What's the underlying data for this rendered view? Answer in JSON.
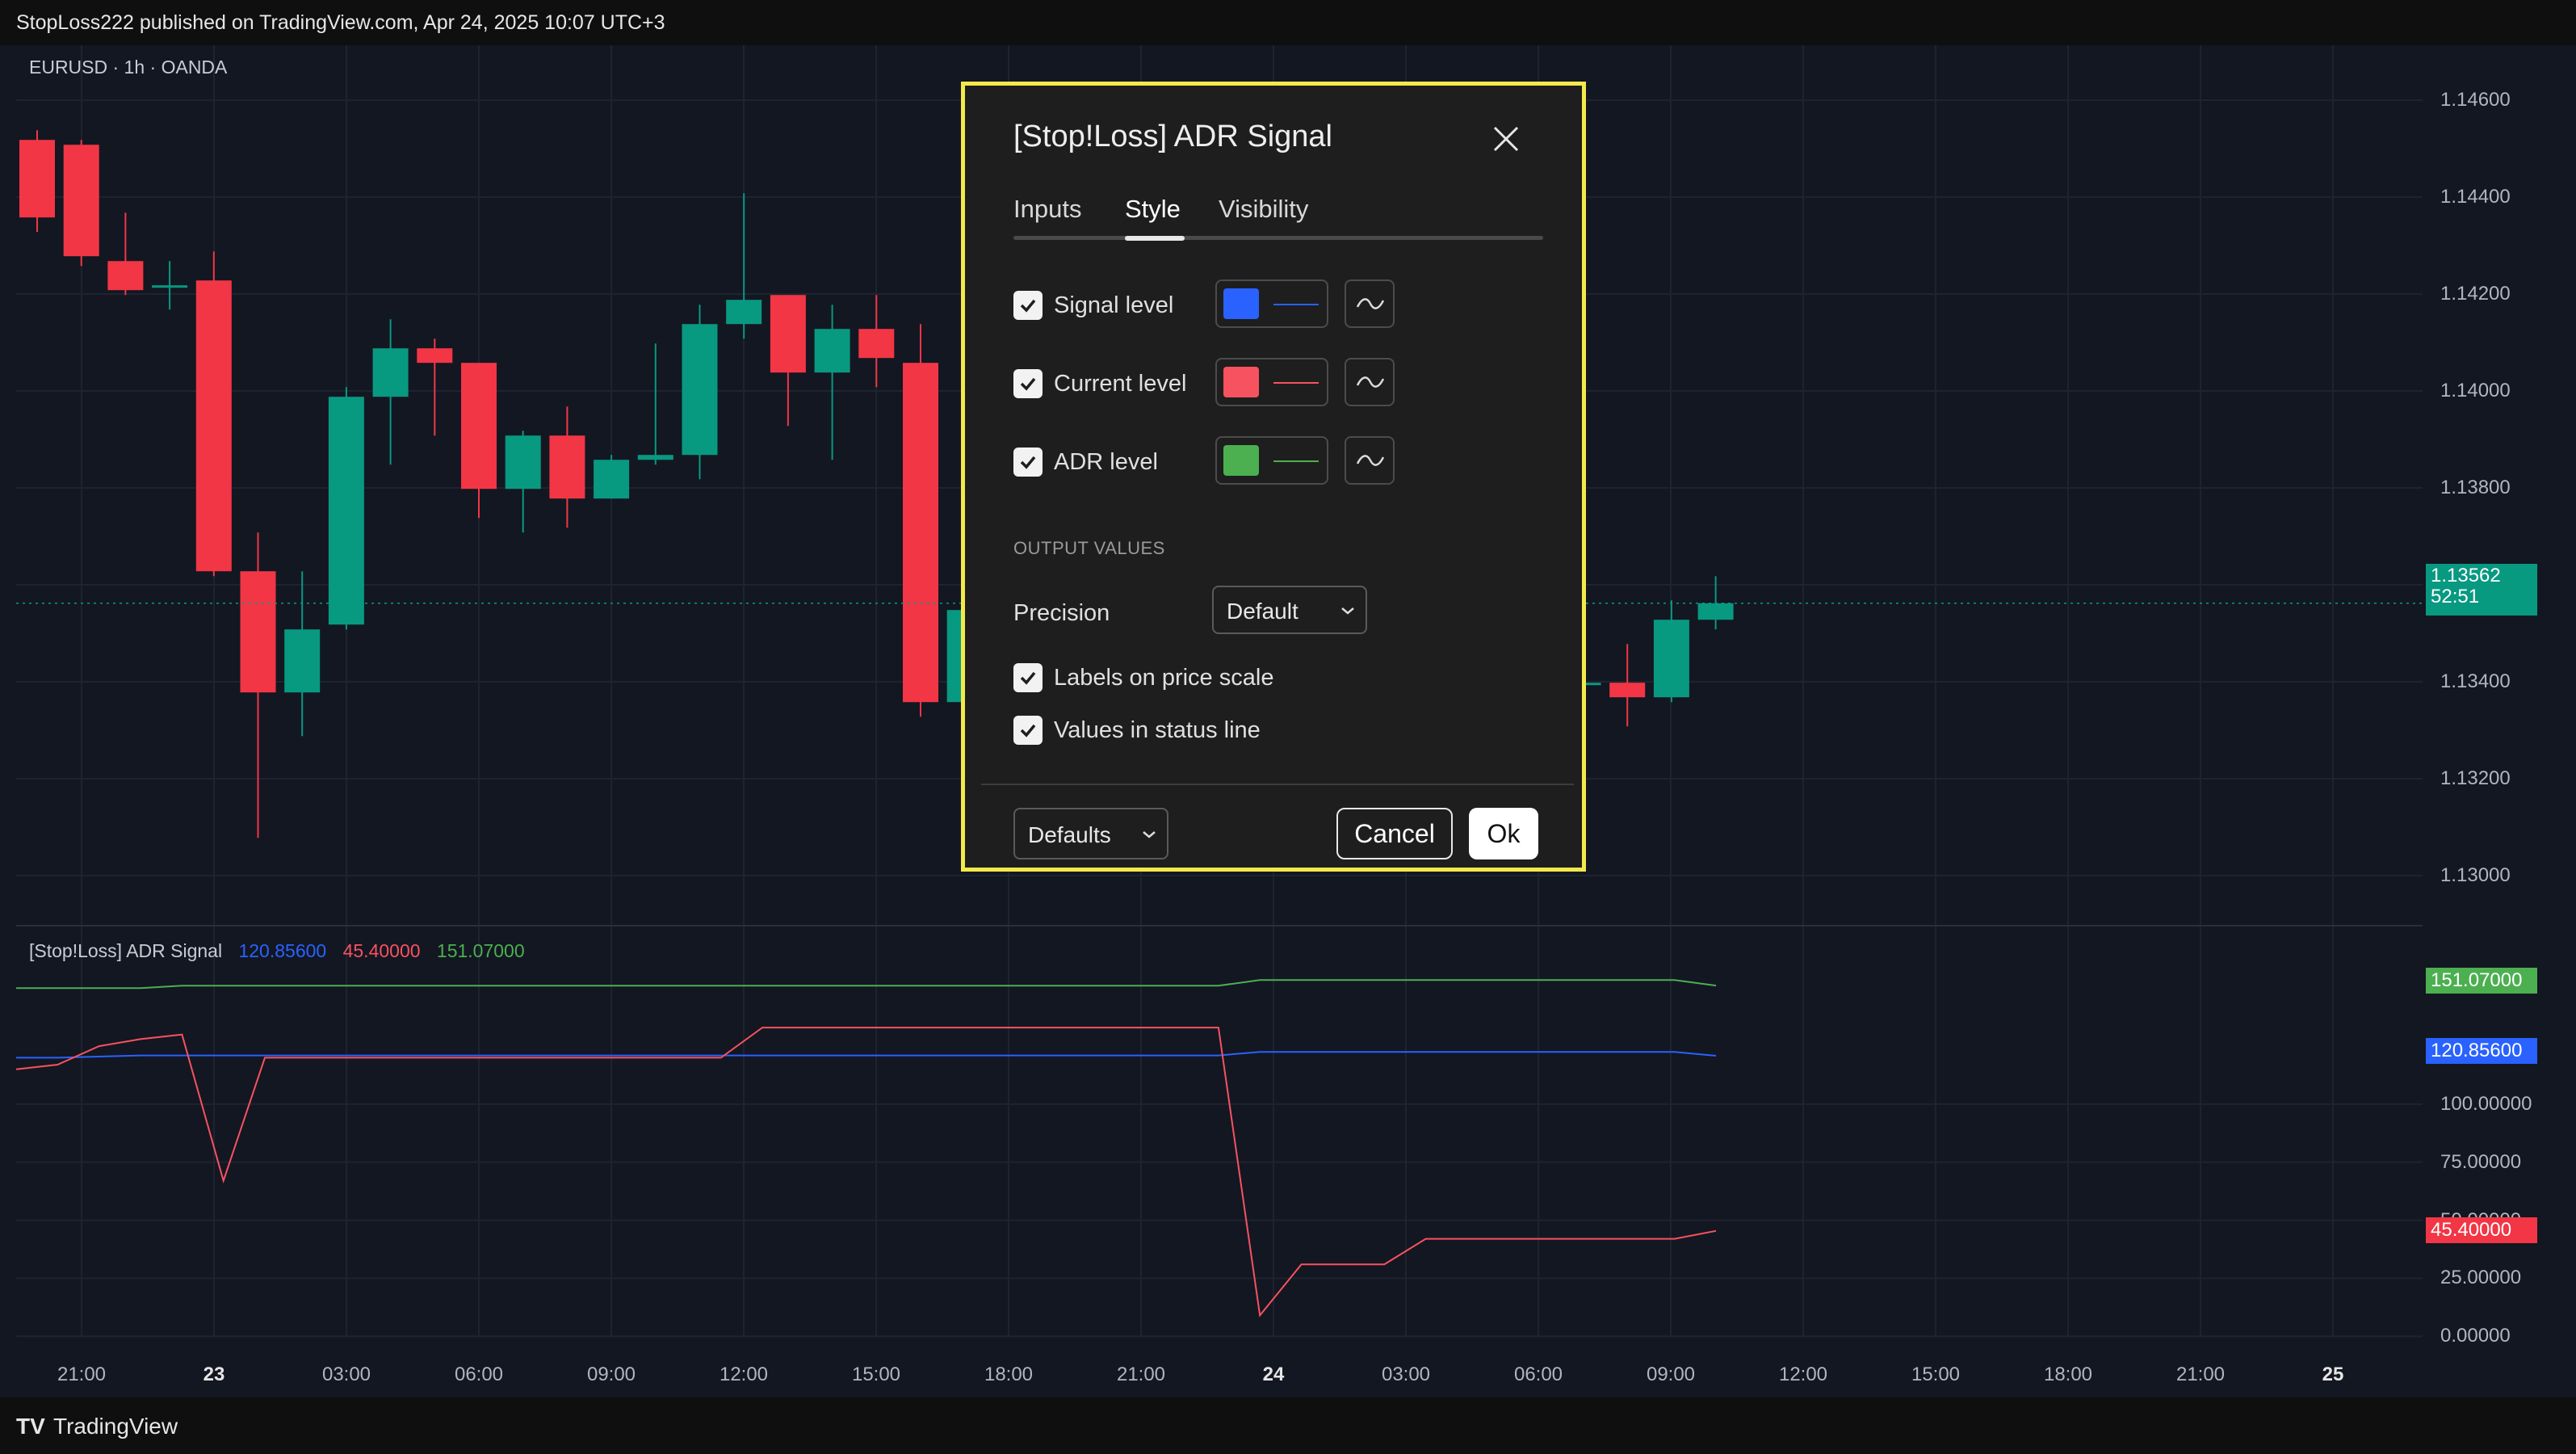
{
  "header": {
    "published_text": "StopLoss222 published on TradingView.com, Apr 24, 2025 10:07 UTC+3"
  },
  "symbol_legend": "EURUSD · 1h · OANDA",
  "indicator_legend": {
    "name": "[Stop!Loss] ADR Signal",
    "signal_value": "120.85600",
    "current_value": "45.40000",
    "adr_value": "151.07000"
  },
  "price_scale": [
    "1.14600",
    "1.14400",
    "1.14200",
    "1.14000",
    "1.13800",
    "1.13600",
    "1.13400",
    "1.13200",
    "1.13000"
  ],
  "indicator_scale": [
    "100.00000",
    "75.00000",
    "50.00000",
    "25.00000",
    "0.00000"
  ],
  "last_price_tag": {
    "price": "1.13562",
    "countdown": "52:51"
  },
  "indicator_tags": {
    "adr": "151.07000",
    "signal": "120.85600",
    "current": "45.40000"
  },
  "time_axis": [
    "21:00",
    "23",
    "03:00",
    "06:00",
    "09:00",
    "12:00",
    "15:00",
    "18:00",
    "21:00",
    "24",
    "03:00",
    "06:00",
    "09:00",
    "12:00",
    "15:00",
    "18:00",
    "21:00",
    "25"
  ],
  "colors": {
    "bull": "#089981",
    "bear": "#f23645",
    "signal": "#2962ff",
    "current": "#f7525f",
    "adr": "#4caf50",
    "tag_green": "#089981",
    "tag_blue": "#2962ff",
    "tag_red": "#f23645",
    "tag_adr": "#4caf50"
  },
  "chart_data": {
    "type": "candlestick",
    "series": [
      {
        "name": "EURUSD",
        "ohlc": [
          [
            1.14518,
            1.14538,
            1.14328,
            1.14358
          ],
          [
            1.14508,
            1.14518,
            1.14258,
            1.14278
          ],
          [
            1.14268,
            1.14368,
            1.14198,
            1.14208
          ],
          [
            1.14218,
            1.14268,
            1.14168,
            1.14218
          ],
          [
            1.14228,
            1.14288,
            1.13618,
            1.13628
          ],
          [
            1.13628,
            1.13708,
            1.13078,
            1.13378
          ],
          [
            1.13378,
            1.13628,
            1.13288,
            1.13508
          ],
          [
            1.13518,
            1.14008,
            1.13508,
            1.13988
          ],
          [
            1.13988,
            1.14148,
            1.13848,
            1.14088
          ],
          [
            1.14088,
            1.14108,
            1.13908,
            1.14058
          ],
          [
            1.14058,
            1.14058,
            1.13738,
            1.13798
          ],
          [
            1.13798,
            1.13918,
            1.13708,
            1.13908
          ],
          [
            1.13908,
            1.13968,
            1.13718,
            1.13778
          ],
          [
            1.13778,
            1.13868,
            1.13778,
            1.13858
          ],
          [
            1.13858,
            1.14098,
            1.13848,
            1.13868
          ],
          [
            1.13868,
            1.14178,
            1.13818,
            1.14138
          ],
          [
            1.14138,
            1.14408,
            1.14108,
            1.14188
          ],
          [
            1.14198,
            1.14198,
            1.13928,
            1.14038
          ],
          [
            1.14038,
            1.14178,
            1.13858,
            1.14128
          ],
          [
            1.14128,
            1.14198,
            1.14008,
            1.14068
          ],
          [
            1.14058,
            1.14138,
            1.13328,
            1.13358
          ],
          [
            1.13358,
            1.13558,
            1.13328,
            1.13548
          ],
          [
            1.13398,
            1.13398,
            1.13398,
            1.13398
          ],
          [
            1.13398,
            1.13478,
            1.13308,
            1.13368
          ],
          [
            1.13368,
            1.13568,
            1.13358,
            1.13528
          ],
          [
            1.13528,
            1.13618,
            1.13508,
            1.13562
          ]
        ]
      },
      {
        "name": "Signal level",
        "values": [
          120,
          120,
          120.5,
          121,
          121,
          121,
          121,
          121,
          121,
          121,
          121,
          121,
          121,
          121,
          121,
          121,
          121,
          121,
          121,
          121,
          121,
          121,
          121,
          121,
          121,
          121,
          121,
          121,
          121,
          121,
          122.5,
          122.5,
          122.5,
          122.5,
          122.5,
          122.5,
          122.5,
          122.5,
          122.5,
          122.5,
          122.5,
          120.86
        ]
      },
      {
        "name": "Current level",
        "values": [
          115,
          117,
          125,
          128,
          130,
          67,
          120,
          120,
          120,
          120,
          120,
          120,
          120,
          120,
          120,
          120,
          120,
          120,
          133,
          133,
          133,
          133,
          133,
          133,
          133,
          133,
          133,
          133,
          133,
          133,
          9,
          31,
          31,
          31,
          42,
          42,
          42,
          42,
          42,
          42,
          42,
          45.4
        ]
      },
      {
        "name": "ADR level",
        "values": [
          150,
          150,
          150,
          150,
          151,
          151,
          151,
          151,
          151,
          151,
          151,
          151,
          151,
          151,
          151,
          151,
          151,
          151,
          151,
          151,
          151,
          151,
          151,
          151,
          151,
          151,
          151,
          151,
          151,
          151,
          153.5,
          153.5,
          153.5,
          153.5,
          153.5,
          153.5,
          153.5,
          153.5,
          153.5,
          153.5,
          153.5,
          151.07
        ]
      }
    ],
    "price_ylim": [
      1.129,
      1.1465
    ],
    "indicator_ylim": [
      -2,
      172
    ]
  },
  "dialog": {
    "title": "[Stop!Loss] ADR Signal",
    "tabs": [
      "Inputs",
      "Style",
      "Visibility"
    ],
    "active_tab": "Style",
    "levels": [
      {
        "label": "Signal level",
        "checked": true,
        "color": "#2962ff"
      },
      {
        "label": "Current level",
        "checked": true,
        "color": "#f7525f"
      },
      {
        "label": "ADR level",
        "checked": true,
        "color": "#4caf50"
      }
    ],
    "output_header": "OUTPUT VALUES",
    "precision_label": "Precision",
    "precision_value": "Default",
    "labels_on_price_scale": "Labels on price scale",
    "values_in_status_line": "Values in status line",
    "defaults_label": "Defaults",
    "cancel_label": "Cancel",
    "ok_label": "Ok"
  },
  "footer": {
    "brand": "TradingView"
  }
}
